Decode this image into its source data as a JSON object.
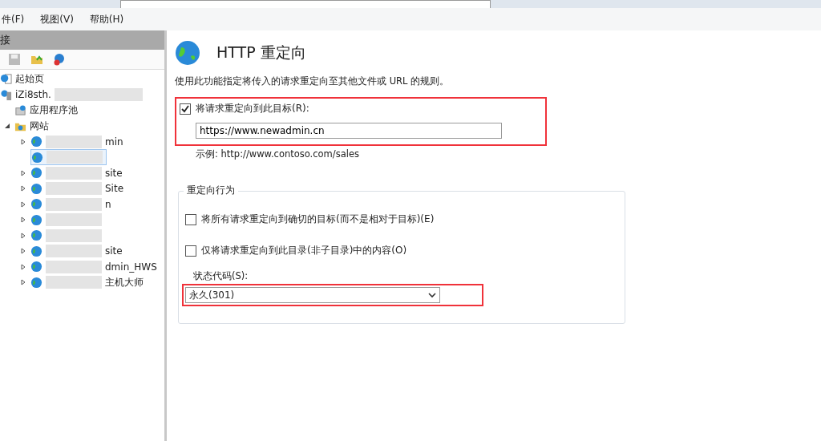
{
  "menu": [
    "件(F)",
    "视图(V)",
    "帮助(H)"
  ],
  "connections": {
    "header": "接",
    "tree": [
      {
        "label": "起始页",
        "kind": "home",
        "blurred": false
      },
      {
        "label": "iZi8sth.",
        "kind": "server",
        "blurred": true,
        "children": [
          {
            "label": "应用程序池",
            "kind": "pool",
            "blurred": false
          },
          {
            "label": "网站",
            "kind": "folder",
            "blurred": false,
            "expanded": true,
            "children": [
              {
                "label": "min",
                "blurred": true,
                "selected": false,
                "expanded": false
              },
              {
                "blurred": true,
                "selected": true
              },
              {
                "label": "site",
                "blurred": true,
                "selected": false,
                "expanded": false
              },
              {
                "label": "Site",
                "blurred": true,
                "selected": false,
                "expanded": false
              },
              {
                "label": "n",
                "blurred": true,
                "selected": false,
                "expanded": false
              },
              {
                "blurred": true,
                "selected": false,
                "expanded": false
              },
              {
                "blurred": true,
                "selected": false,
                "expanded": false
              },
              {
                "label": "site",
                "blurred": true,
                "selected": false,
                "expanded": false
              },
              {
                "label": "dmin_HWS",
                "blurred": true,
                "selected": false,
                "expanded": false
              },
              {
                "label": "主机大师",
                "blurred": true,
                "selected": false,
                "expanded": false
              }
            ]
          }
        ]
      }
    ]
  },
  "feature": {
    "title": "HTTP 重定向",
    "description": "使用此功能指定将传入的请求重定向至其他文件或 URL 的规则。",
    "redirect": {
      "label": "将请求重定向到此目标(R):",
      "checked": true,
      "value": "https://www.newadmin.cn",
      "example": "示例: http://www.contoso.com/sales"
    },
    "behavior": {
      "legend": "重定向行为",
      "options": [
        {
          "label": "将所有请求重定向到确切的目标(而不是相对于目标)(E)",
          "checked": false
        },
        {
          "label": "仅将请求重定向到此目录(非子目录)中的内容(O)",
          "checked": false
        }
      ],
      "status_label": "状态代码(S):",
      "status_value": "永久(301)"
    }
  }
}
